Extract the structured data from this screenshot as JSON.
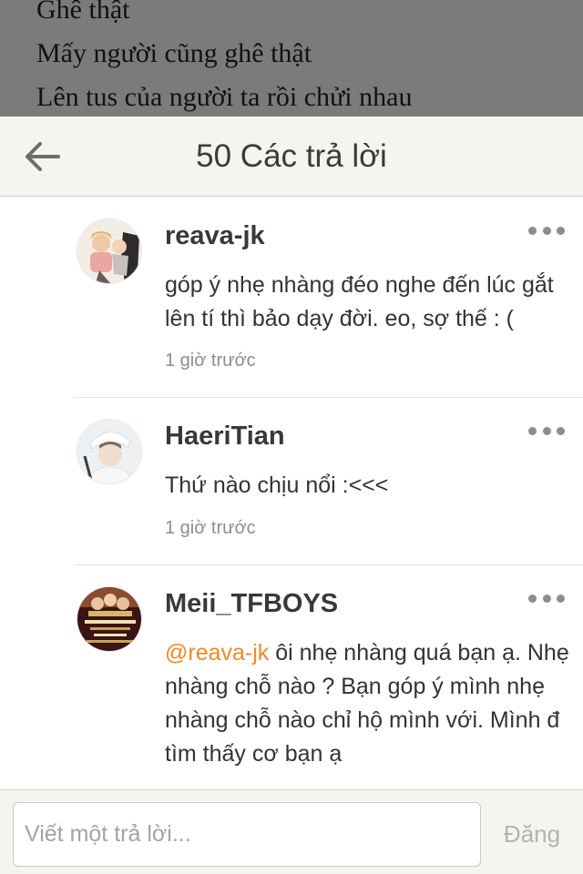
{
  "background_post": {
    "lines": [
      "Ghê thật",
      "Mấy người cũng ghê thật",
      "Lên tus của người ta rồi chửi nhau"
    ]
  },
  "header": {
    "title": "50 Các trả lời",
    "back_icon": "arrow-left-icon"
  },
  "replies": [
    {
      "username": "reava-jk",
      "mention": "",
      "text": "góp ý nhẹ nhàng đéo nghe đến lúc gắt lên tí thì bảo dạy đời. eo, sợ thế : (",
      "time": "1 giờ trước"
    },
    {
      "username": "HaeriTian",
      "mention": "",
      "text": "Thứ nào chịu nổi :<<<",
      "time": "1 giờ trước"
    },
    {
      "username": "Meii_TFBOYS",
      "mention": "@reava-jk",
      "text": " ôi nhẹ nhàng quá bạn ạ. Nhẹ nhàng chỗ nào ? Bạn góp ý mình nhẹ nhàng chỗ nào chỉ hộ mình với. Mình đ tìm thấy cơ bạn ạ",
      "time": ""
    }
  ],
  "composer": {
    "placeholder": "Viết một trả lời...",
    "post_label": "Đăng"
  },
  "colors": {
    "mention": "#ef8a2a",
    "header_bg": "#f5f4ef",
    "overlay": "#7b7b7b"
  }
}
